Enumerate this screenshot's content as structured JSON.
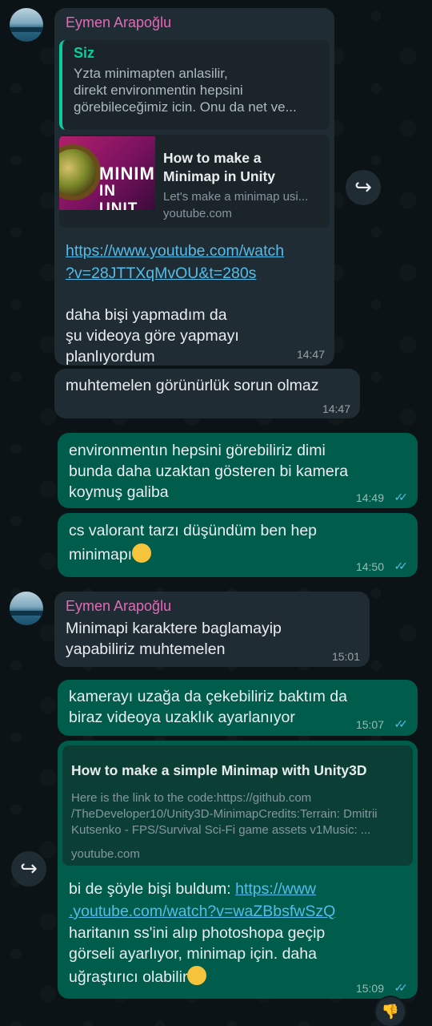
{
  "chat": {
    "m1": {
      "sender": "Eymen Arapoğlu",
      "quote_author": "Siz",
      "quote_line1": "Yzta minimapten anlasilir,",
      "quote_line2": "direkt environmentin hepsini",
      "quote_line3": "görebileceğimiz icin. Onu da net ve...",
      "preview_title1": "How to make a",
      "preview_title2": "Minimap in Unity",
      "preview_desc": "Let's make a minimap usi...",
      "preview_site": "youtube.com",
      "thumb_text1": "MINIM",
      "thumb_text2": "IN UNIT",
      "link1": "https://www.youtube.com/watch",
      "link2": "?v=28JTTXqMvOU&t=280s",
      "text1": "daha bişi yapmadım da",
      "text2": "şu videoya göre yapmayı",
      "text3": "planlıyordum",
      "time": "14:47"
    },
    "m2": {
      "text": "muhtemelen görünürlük sorun olmaz",
      "time": "14:47"
    },
    "m3": {
      "line1": "environmentın hepsini görebiliriz dimi",
      "line2": "bunda daha uzaktan gösteren bi kamera",
      "line3": "koymuş galiba",
      "time": "14:49"
    },
    "m4": {
      "line1": "cs valorant tarzı düşündüm ben hep",
      "line2": "minimapı",
      "time": "14:50"
    },
    "m5": {
      "sender": "Eymen Arapoğlu",
      "line1": "Minimapi karaktere baglamayip",
      "line2": "yapabiliriz muhtemelen",
      "time": "15:01"
    },
    "m6": {
      "line1": "kamerayı uzağa da çekebiliriz baktım da",
      "line2": "biraz videoya uzaklık ayarlanıyor",
      "time": "15:07"
    },
    "m7": {
      "preview_title": "How to make a simple Minimap with Unity3D",
      "preview_desc1": "Here is the link to the code:https://github.com",
      "preview_desc2": "/TheDeveloper10/Unity3D-MinimapCredits:Terrain: Dmitrii",
      "preview_desc3": "Kutsenko - FPS/Survival Sci-Fi game assets v1Music: ...",
      "preview_site": "youtube.com",
      "text1_pre": "bi de şöyle bişi buldum: ",
      "link1": "https://www",
      "link2": ".youtube.com/watch?v=waZBbsfwSzQ",
      "text2": "haritanın ss'ini alıp photoshopa geçip",
      "text3": "görseli ayarlıyor, minimap için. daha",
      "text4": "uğraştırıcı olabilir",
      "time": "15:09"
    }
  },
  "icons": {
    "forward": "↪",
    "ticks": "✓✓",
    "reaction": "👎"
  },
  "colors": {
    "incoming_bubble": "#202c33",
    "outgoing_bubble": "#005c4b",
    "sender_name": "#e26ab6",
    "link": "#53bdeb",
    "read_ticks": "#53bdeb"
  }
}
